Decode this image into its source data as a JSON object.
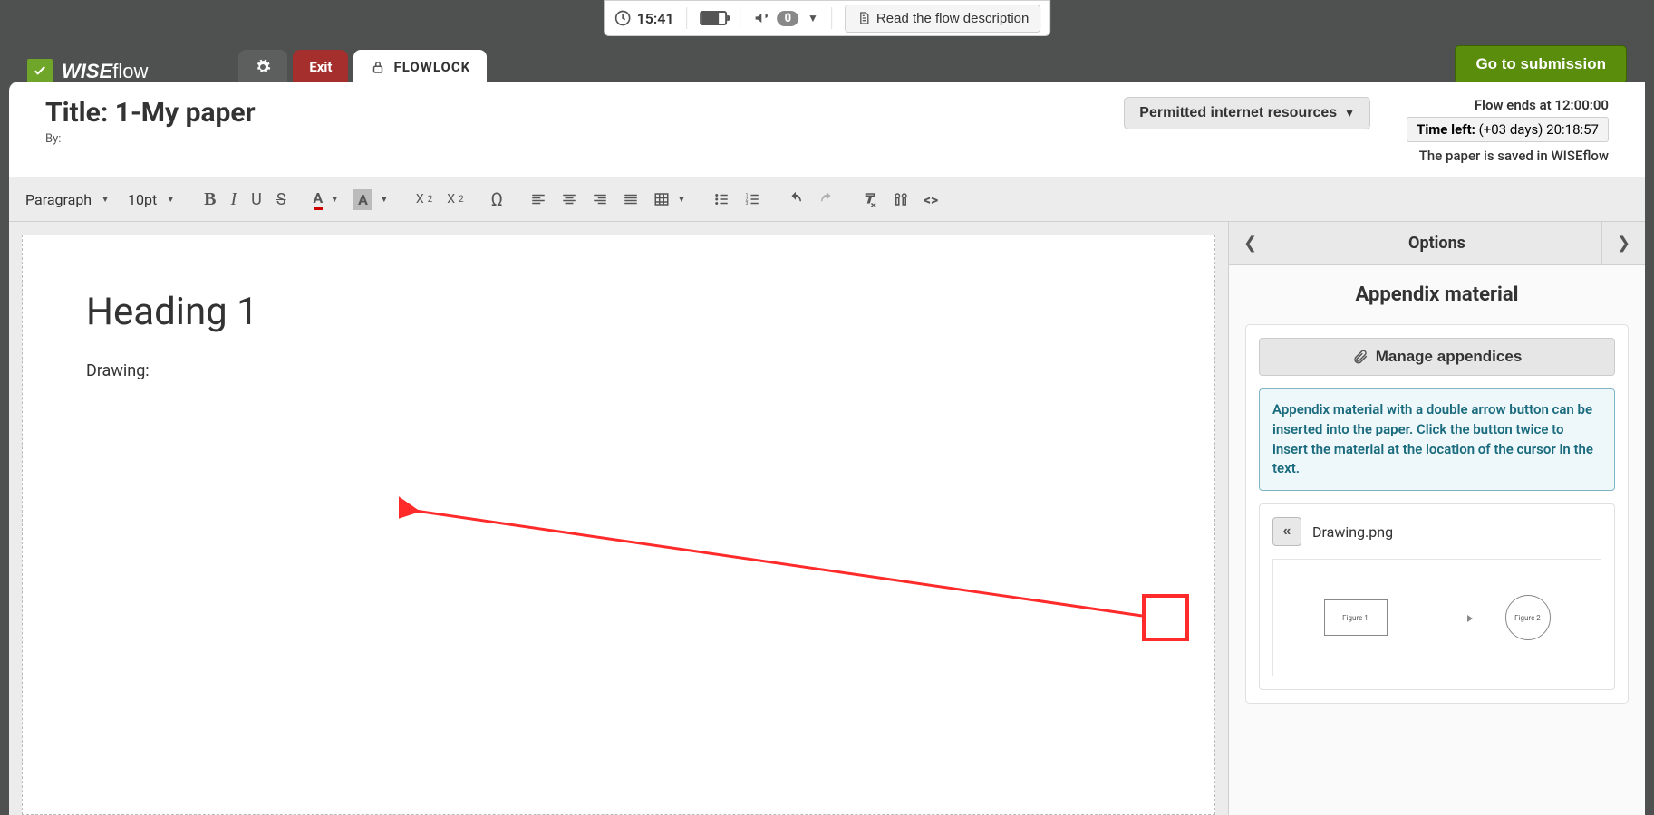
{
  "topbar": {
    "time": "15:41",
    "notif_count": "0",
    "read_flow": "Read the flow description"
  },
  "nav": {
    "brand": "WISEflow",
    "exit": "Exit",
    "flowlock": "FLOWLOCK",
    "go": "Go to submission"
  },
  "header": {
    "title": "Title: 1-My paper",
    "by": "By:",
    "perm": "Permitted internet resources",
    "ends": "Flow ends at 12:00:00",
    "timeleft_label": "Time left:",
    "timeleft_days": "(+03 days)",
    "timeleft_clock": "20:18:57",
    "saved": "The paper is saved in WISEflow"
  },
  "toolbar": {
    "style": "Paragraph",
    "size": "10pt"
  },
  "document": {
    "heading": "Heading 1",
    "body": "Drawing:"
  },
  "sidebar": {
    "options": "Options",
    "title": "Appendix material",
    "manage": "Manage appendices",
    "info": "Appendix material with a double arrow button can be inserted into the paper. Click the button twice to insert the material at the location of the cursor in the text.",
    "file": "Drawing.png",
    "fig1": "Figure 1",
    "fig2": "Figure 2"
  }
}
